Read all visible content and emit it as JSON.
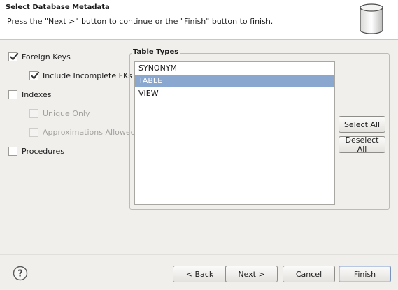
{
  "header": {
    "title": "Select Database Metadata",
    "subtitle": "Press the \"Next >\" button to continue or the \"Finish\" button to finish.",
    "icon": "database-icon"
  },
  "options": [
    {
      "key": "foreign_keys",
      "label": "Foreign Keys",
      "checked": true,
      "enabled": true
    },
    {
      "key": "include_incomplete_fks",
      "label": "Include Incomplete FKs",
      "checked": true,
      "enabled": true
    },
    {
      "key": "indexes",
      "label": "Indexes",
      "checked": false,
      "enabled": true
    },
    {
      "key": "unique_only",
      "label": "Unique Only",
      "checked": false,
      "enabled": false
    },
    {
      "key": "approximations_allowed",
      "label": "Approximations Allowed",
      "checked": false,
      "enabled": false
    },
    {
      "key": "procedures",
      "label": "Procedures",
      "checked": false,
      "enabled": true
    }
  ],
  "table_types": {
    "title": "Table Types",
    "items": [
      {
        "label": "SYNONYM",
        "selected": false
      },
      {
        "label": "TABLE",
        "selected": true
      },
      {
        "label": "VIEW",
        "selected": false
      }
    ],
    "select_all_label": "Select All",
    "deselect_all_label": "Deselect All"
  },
  "footer": {
    "help_icon": "help-icon",
    "back_label": "< Back",
    "next_label": "Next >",
    "cancel_label": "Cancel",
    "finish_label": "Finish"
  },
  "colors": {
    "selection": "#8aa8cf",
    "background": "#f0efec"
  }
}
